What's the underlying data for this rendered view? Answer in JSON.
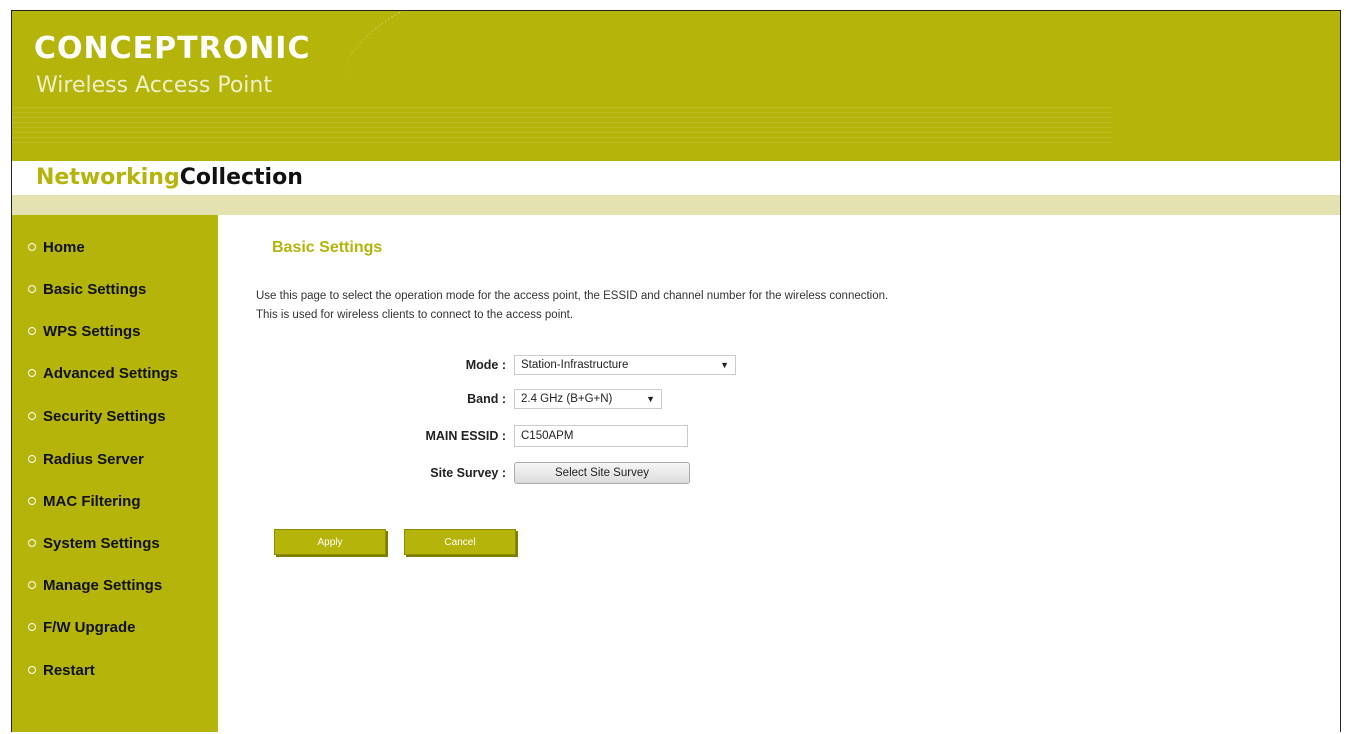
{
  "header": {
    "brand": "CONCEPTRONIC",
    "subtitle": "Wireless Access Point",
    "collection_part1": "Networking",
    "collection_part2": "Collection"
  },
  "sidebar": {
    "items": [
      {
        "label": "Home"
      },
      {
        "label": "Basic Settings"
      },
      {
        "label": "WPS Settings"
      },
      {
        "label": "Advanced Settings"
      },
      {
        "label": "Security Settings"
      },
      {
        "label": "Radius Server"
      },
      {
        "label": "MAC Filtering"
      },
      {
        "label": "System Settings"
      },
      {
        "label": "Manage Settings"
      },
      {
        "label": "F/W Upgrade"
      },
      {
        "label": "Restart"
      }
    ]
  },
  "main": {
    "title": "Basic Settings",
    "description_line1": "Use this page to select the operation mode for the access point, the ESSID and channel number for the wireless connection.",
    "description_line2": "This is used for wireless clients to connect to the access point.",
    "form": {
      "mode_label": "Mode :",
      "mode_value": "Station-Infrastructure",
      "band_label": "Band :",
      "band_value": "2.4 GHz (B+G+N)",
      "essid_label": "MAIN ESSID :",
      "essid_value": "C150APM",
      "site_survey_label": "Site Survey :",
      "site_survey_button": "Select Site Survey"
    },
    "buttons": {
      "apply": "Apply",
      "cancel": "Cancel"
    }
  },
  "colors": {
    "accent": "#b4b40a",
    "strip": "#e3e2b0"
  }
}
